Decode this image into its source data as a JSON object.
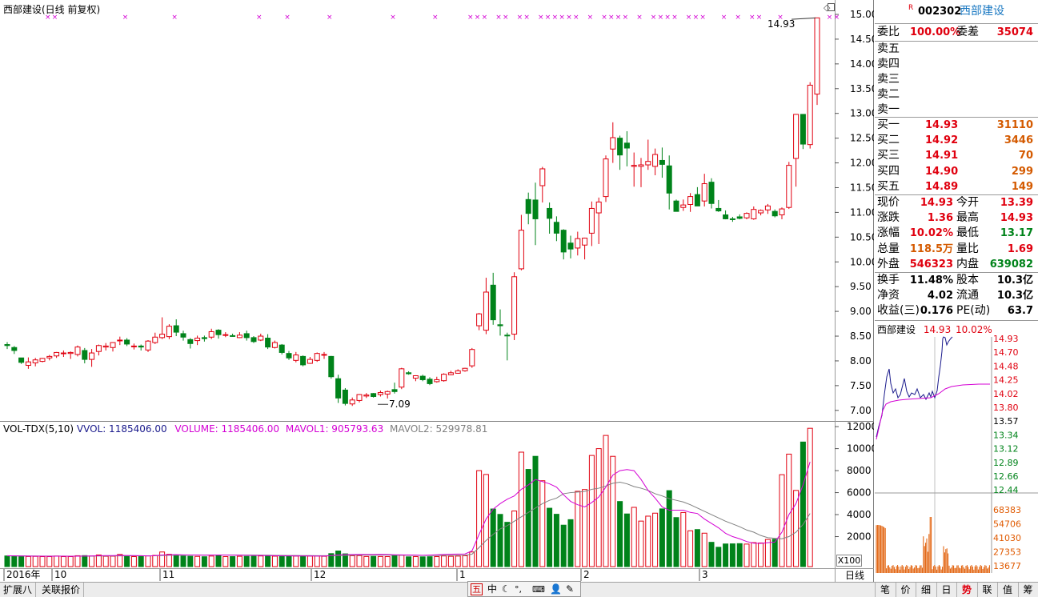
{
  "window": {
    "title": "西部建设(日线 前复权)"
  },
  "colors": {
    "up": "#e0000f",
    "down": "#00831a",
    "mavol1": "#d400d4",
    "mavol2": "#808080",
    "intraday_price": "#1a1a8c",
    "intraday_avg": "#d400d4",
    "intraday_volume": "#e05a00"
  },
  "kline": {
    "price_ticks": [
      "15.00",
      "14.50",
      "14.00",
      "13.50",
      "13.00",
      "12.50",
      "12.00",
      "11.50",
      "11.00",
      "10.50",
      "10.00",
      "9.50",
      "9.00",
      "8.50",
      "8.00",
      "7.50",
      "7.00"
    ],
    "annotations": {
      "high_label": "14.93",
      "low_label": "7.09"
    },
    "x_labels": [
      "2016年",
      "10",
      "11",
      "12",
      "1",
      "2",
      "3"
    ],
    "period_tab": "日线"
  },
  "volume_panel": {
    "indicator_name": "VOL-TDX(5,10)",
    "vvol": "VVOL: 1185406.00",
    "volume": "VOLUME: 1185406.00",
    "mavol1": "MAVOL1: 905793.63",
    "mavol2": "MAVOL2: 529978.81",
    "y_ticks": [
      "12000",
      "10000",
      "8000",
      "6000",
      "4000",
      "2000"
    ],
    "unit": "X100"
  },
  "chart_data": {
    "type": "candlestick",
    "title": "西部建设(日线 前复权)",
    "candles_ohlc": [
      [
        8.33,
        8.38,
        8.24,
        8.31
      ],
      [
        8.27,
        8.3,
        8.14,
        8.21
      ],
      [
        8.06,
        8.05,
        7.94,
        7.97
      ],
      [
        7.91,
        8.07,
        7.84,
        7.98
      ],
      [
        7.96,
        8.06,
        7.89,
        8.02
      ],
      [
        7.99,
        8.06,
        7.97,
        8.05
      ],
      [
        8.06,
        8.12,
        8.01,
        8.09
      ],
      [
        8.1,
        8.18,
        8.06,
        8.17
      ],
      [
        8.16,
        8.21,
        8.08,
        8.16
      ],
      [
        8.15,
        8.19,
        8.04,
        8.17
      ],
      [
        8.13,
        8.31,
        8.09,
        8.28
      ],
      [
        8.21,
        8.26,
        7.95,
        8.03
      ],
      [
        8.03,
        8.24,
        7.88,
        8.16
      ],
      [
        8.19,
        8.33,
        8.11,
        8.31
      ],
      [
        8.28,
        8.36,
        8.21,
        8.3
      ],
      [
        8.27,
        8.38,
        8.19,
        8.37
      ],
      [
        8.42,
        8.49,
        8.32,
        8.42
      ],
      [
        8.42,
        8.46,
        8.3,
        8.34
      ],
      [
        8.3,
        8.35,
        8.23,
        8.3
      ],
      [
        8.3,
        8.33,
        8.21,
        8.28
      ],
      [
        8.22,
        8.42,
        8.18,
        8.4
      ],
      [
        8.37,
        8.57,
        8.34,
        8.48
      ],
      [
        8.47,
        8.88,
        8.44,
        8.54
      ],
      [
        8.49,
        8.74,
        8.44,
        8.7
      ],
      [
        8.71,
        8.84,
        8.5,
        8.58
      ],
      [
        8.55,
        8.61,
        8.41,
        8.48
      ],
      [
        8.43,
        8.46,
        8.25,
        8.35
      ],
      [
        8.41,
        8.51,
        8.32,
        8.46
      ],
      [
        8.47,
        8.51,
        8.39,
        8.45
      ],
      [
        8.48,
        8.65,
        8.44,
        8.59
      ],
      [
        8.62,
        8.64,
        8.45,
        8.53
      ],
      [
        8.53,
        8.58,
        8.48,
        8.53
      ],
      [
        8.51,
        8.55,
        8.49,
        8.5
      ],
      [
        8.47,
        8.58,
        8.46,
        8.52
      ],
      [
        8.55,
        8.61,
        8.41,
        8.47
      ],
      [
        8.47,
        8.5,
        8.36,
        8.39
      ],
      [
        8.42,
        8.55,
        8.4,
        8.5
      ],
      [
        8.46,
        8.54,
        8.24,
        8.28
      ],
      [
        8.27,
        8.41,
        8.25,
        8.37
      ],
      [
        8.32,
        8.34,
        8.13,
        8.17
      ],
      [
        8.15,
        8.2,
        8.02,
        8.06
      ],
      [
        8.01,
        8.18,
        7.97,
        8.12
      ],
      [
        8.09,
        8.11,
        7.89,
        7.92
      ],
      [
        7.95,
        8.08,
        7.94,
        8.03
      ],
      [
        8.01,
        8.17,
        7.98,
        8.15
      ],
      [
        8.12,
        8.18,
        8.04,
        8.13
      ],
      [
        8.09,
        8.1,
        7.64,
        7.68
      ],
      [
        7.64,
        7.72,
        7.15,
        7.25
      ],
      [
        7.41,
        7.45,
        7.1,
        7.14
      ],
      [
        7.13,
        7.26,
        7.09,
        7.21
      ],
      [
        7.2,
        7.33,
        7.16,
        7.32
      ],
      [
        7.29,
        7.35,
        7.25,
        7.31
      ],
      [
        7.34,
        7.35,
        7.26,
        7.28
      ],
      [
        7.32,
        7.4,
        7.28,
        7.36
      ],
      [
        7.33,
        7.4,
        7.24,
        7.38
      ],
      [
        7.42,
        7.56,
        7.34,
        7.38
      ],
      [
        7.47,
        7.86,
        7.43,
        7.84
      ],
      [
        7.76,
        7.79,
        7.72,
        7.74
      ],
      [
        7.65,
        7.71,
        7.59,
        7.7
      ],
      [
        7.69,
        7.72,
        7.59,
        7.62
      ],
      [
        7.63,
        7.67,
        7.51,
        7.54
      ],
      [
        7.58,
        7.68,
        7.56,
        7.62
      ],
      [
        7.6,
        7.75,
        7.58,
        7.73
      ],
      [
        7.72,
        7.8,
        7.71,
        7.76
      ],
      [
        7.75,
        7.83,
        7.74,
        7.8
      ],
      [
        7.8,
        7.86,
        7.78,
        7.85
      ],
      [
        7.9,
        8.26,
        7.86,
        8.23
      ],
      [
        8.71,
        8.97,
        8.62,
        8.95
      ],
      [
        8.62,
        9.68,
        8.54,
        9.39
      ],
      [
        9.53,
        9.78,
        8.73,
        8.83
      ],
      [
        8.73,
        9.04,
        8.51,
        8.71
      ],
      [
        8.52,
        8.57,
        8.01,
        8.51
      ],
      [
        8.54,
        9.79,
        8.42,
        9.7
      ],
      [
        9.86,
        10.95,
        9.83,
        10.64
      ],
      [
        11.26,
        11.4,
        10.76,
        10.98
      ],
      [
        11.25,
        11.6,
        10.34,
        10.87
      ],
      [
        11.54,
        11.92,
        11.2,
        11.88
      ],
      [
        11.08,
        11.2,
        10.57,
        10.88
      ],
      [
        10.8,
        10.92,
        10.42,
        10.58
      ],
      [
        10.64,
        10.66,
        10.05,
        10.2
      ],
      [
        10.38,
        10.53,
        10.07,
        10.26
      ],
      [
        10.28,
        10.61,
        10.13,
        10.47
      ],
      [
        10.34,
        10.49,
        10.05,
        10.48
      ],
      [
        10.58,
        11.22,
        10.32,
        11.08
      ],
      [
        10.99,
        11.3,
        10.36,
        11.21
      ],
      [
        11.32,
        12.15,
        11.21,
        12.08
      ],
      [
        12.28,
        12.82,
        12.0,
        12.51
      ],
      [
        12.5,
        12.55,
        11.86,
        12.16
      ],
      [
        12.4,
        12.64,
        11.93,
        12.3
      ],
      [
        11.93,
        12.21,
        11.52,
        11.95
      ],
      [
        11.93,
        12.1,
        11.51,
        11.96
      ],
      [
        11.96,
        12.47,
        11.86,
        12.03
      ],
      [
        11.93,
        12.29,
        11.75,
        12.17
      ],
      [
        12.05,
        12.31,
        11.7,
        11.97
      ],
      [
        11.94,
        12.15,
        11.06,
        11.39
      ],
      [
        11.23,
        11.26,
        11.04,
        11.02
      ],
      [
        11.1,
        11.26,
        11.03,
        11.15
      ],
      [
        11.16,
        11.39,
        11.01,
        11.32
      ],
      [
        11.36,
        11.51,
        11.15,
        11.13
      ],
      [
        11.23,
        11.78,
        11.12,
        11.58
      ],
      [
        11.61,
        11.69,
        11.08,
        11.18
      ],
      [
        11.08,
        11.25,
        11.01,
        11.03
      ],
      [
        10.95,
        11.04,
        10.86,
        10.87
      ],
      [
        10.87,
        10.91,
        10.81,
        10.86
      ],
      [
        10.91,
        10.96,
        10.86,
        10.88
      ],
      [
        10.89,
        11.0,
        10.86,
        10.98
      ],
      [
        10.87,
        11.12,
        10.85,
        11.06
      ],
      [
        10.99,
        11.06,
        10.94,
        11.04
      ],
      [
        11.05,
        11.17,
        10.97,
        11.13
      ],
      [
        11.02,
        11.06,
        10.9,
        10.93
      ],
      [
        10.95,
        11.1,
        10.86,
        11.07
      ],
      [
        11.1,
        12.02,
        11.07,
        11.95
      ],
      [
        12.09,
        12.52,
        11.52,
        12.98
      ],
      [
        12.98,
        12.98,
        12.28,
        12.38
      ],
      [
        12.37,
        13.63,
        12.29,
        13.57
      ],
      [
        13.39,
        14.93,
        13.17,
        14.93
      ]
    ],
    "volume_x100": [
      240,
      230,
      180,
      190,
      200,
      180,
      180,
      230,
      180,
      180,
      260,
      270,
      230,
      330,
      210,
      220,
      380,
      230,
      180,
      180,
      250,
      290,
      600,
      390,
      270,
      230,
      210,
      200,
      170,
      230,
      260,
      180,
      180,
      210,
      200,
      210,
      240,
      250,
      220,
      240,
      230,
      230,
      220,
      230,
      240,
      210,
      450,
      690,
      430,
      260,
      270,
      190,
      200,
      190,
      180,
      270,
      310,
      160,
      180,
      160,
      170,
      180,
      240,
      210,
      230,
      260,
      600,
      8000,
      7650,
      4510,
      4020,
      3300,
      4330,
      9680,
      8110,
      9300,
      7080,
      4580,
      4030,
      3040,
      3540,
      6120,
      6280,
      9380,
      10000,
      11200,
      9300,
      5190,
      4060,
      4660,
      3410,
      3860,
      4130,
      4520,
      6180,
      3730,
      4190,
      2530,
      2640,
      2310,
      1480,
      1030,
      1330,
      1340,
      1360,
      1320,
      1450,
      1420,
      1740,
      1760,
      7630,
      9500,
      6200,
      10600,
      11850
    ],
    "mavol1_x100": [
      260,
      250,
      240,
      230,
      220,
      220,
      210,
      220,
      220,
      210,
      220,
      230,
      240,
      260,
      270,
      270,
      290,
      280,
      270,
      260,
      240,
      260,
      330,
      350,
      360,
      340,
      330,
      330,
      310,
      320,
      330,
      320,
      310,
      310,
      300,
      290,
      280,
      270,
      260,
      250,
      250,
      240,
      240,
      240,
      230,
      230,
      270,
      340,
      360,
      370,
      380,
      370,
      370,
      380,
      370,
      350,
      340,
      330,
      320,
      300,
      320,
      350,
      380,
      400,
      410,
      420,
      700,
      2200,
      3600,
      4500,
      5000,
      5400,
      5700,
      6300,
      6700,
      7200,
      7000,
      6800,
      6500,
      5800,
      5200,
      4900,
      4700,
      5100,
      5600,
      6500,
      7600,
      8000,
      8100,
      8000,
      7200,
      6200,
      5500,
      4700,
      4400,
      4400,
      4400,
      4200,
      4100,
      3600,
      3200,
      2800,
      2300,
      2000,
      1800,
      1550,
      1400,
      1380,
      1450,
      1500,
      2400,
      4000,
      5000,
      6700,
      8800
    ],
    "mavol2_x100": [
      250,
      250,
      245,
      240,
      235,
      230,
      230,
      225,
      225,
      220,
      225,
      230,
      230,
      235,
      240,
      245,
      250,
      255,
      255,
      255,
      255,
      260,
      280,
      300,
      310,
      310,
      320,
      320,
      320,
      325,
      330,
      330,
      325,
      320,
      320,
      315,
      310,
      305,
      295,
      290,
      285,
      280,
      275,
      270,
      265,
      260,
      265,
      285,
      295,
      305,
      315,
      320,
      320,
      320,
      315,
      310,
      305,
      300,
      295,
      290,
      285,
      285,
      290,
      295,
      300,
      310,
      400,
      1000,
      1650,
      2200,
      2700,
      3000,
      3400,
      3800,
      4200,
      4600,
      5000,
      5300,
      5500,
      5900,
      6000,
      6050,
      6100,
      6300,
      6400,
      6600,
      6850,
      6950,
      6800,
      6550,
      6400,
      6200,
      5900,
      5700,
      5450,
      5300,
      5150,
      4900,
      4600,
      4300,
      4000,
      3700,
      3400,
      3150,
      2900,
      2600,
      2400,
      2100,
      1900,
      1850,
      1800,
      2000,
      2400,
      3100,
      4100
    ],
    "intraday": {
      "stock": "西部建设",
      "price": "14.93",
      "change_pct": "10.02%",
      "price_scale": [
        "14.93",
        "14.70",
        "14.48",
        "14.25",
        "14.02",
        "13.80",
        "13.57",
        "13.34",
        "13.12",
        "12.89",
        "12.66",
        "12.44"
      ],
      "volume_scale": [
        "68383",
        "54706",
        "41030",
        "27353",
        "13677"
      ]
    }
  },
  "quote": {
    "code": "002302",
    "name": "西部建设",
    "badge": "R",
    "weibi_label": "委比",
    "weibi_value": "100.00%",
    "weicha_label": "委差",
    "weicha_value": "35074",
    "sell_levels": [
      "卖五",
      "卖四",
      "卖三",
      "卖二",
      "卖一"
    ],
    "buy_levels": [
      {
        "label": "买一",
        "price": "14.93",
        "volume": "31110"
      },
      {
        "label": "买二",
        "price": "14.92",
        "volume": "3446"
      },
      {
        "label": "买三",
        "price": "14.91",
        "volume": "70"
      },
      {
        "label": "买四",
        "price": "14.90",
        "volume": "299"
      },
      {
        "label": "买五",
        "price": "14.89",
        "volume": "149"
      }
    ],
    "stats": [
      {
        "l1": "现价",
        "v1": "14.93",
        "l2": "今开",
        "v2": "13.39",
        "c1": "red",
        "c2": "red"
      },
      {
        "l1": "涨跌",
        "v1": "1.36",
        "l2": "最高",
        "v2": "14.93",
        "c1": "red",
        "c2": "red"
      },
      {
        "l1": "涨幅",
        "v1": "10.02%",
        "l2": "最低",
        "v2": "13.17",
        "c1": "red",
        "c2": "green"
      },
      {
        "l1": "总量",
        "v1": "118.5万",
        "l2": "量比",
        "v2": "1.69",
        "c1": "orange",
        "c2": "red"
      },
      {
        "l1": "外盘",
        "v1": "546323",
        "l2": "内盘",
        "v2": "639082",
        "c1": "red",
        "c2": "green"
      }
    ],
    "fundamentals": [
      {
        "l1": "换手",
        "v1": "11.48%",
        "l2": "股本",
        "v2": "10.3亿"
      },
      {
        "l1": "净资",
        "v1": "4.02",
        "l2": "流通",
        "v2": "10.3亿"
      },
      {
        "l1": "收益(三)",
        "v1": "0.176",
        "l2": "PE(动)",
        "v2": "63.7"
      }
    ]
  },
  "bottom_tabs": {
    "left": [
      "扩展八",
      "关联报价"
    ],
    "right": [
      "笔",
      "价",
      "细",
      "日",
      "势",
      "联",
      "值",
      "筹"
    ],
    "active_right": "势"
  },
  "ime": {
    "mode_icon": "五",
    "lang": "中",
    "punct": "°,",
    "items": [
      "keyboard-icon",
      "user-icon",
      "settings-icon"
    ]
  }
}
